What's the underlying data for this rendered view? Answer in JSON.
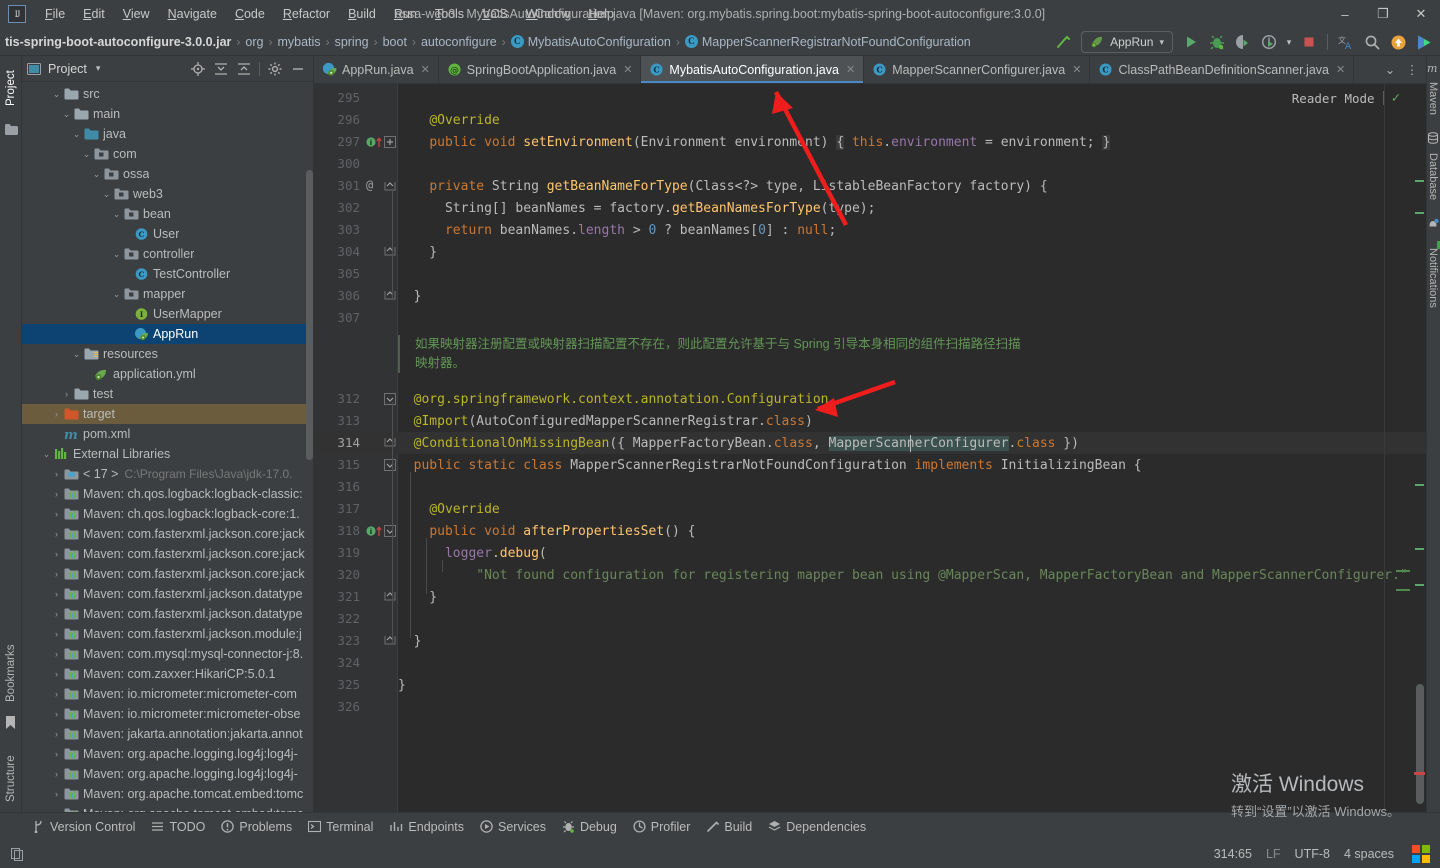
{
  "window": {
    "title": "ossa-web3 - MybatisAutoConfiguration.java [Maven: org.mybatis.spring.boot:mybatis-spring-boot-autoconfigure:3.0.0]",
    "minimize": "–",
    "maximize": "❐",
    "close": "✕",
    "logo": "IJ"
  },
  "menu": {
    "items": [
      {
        "label": "File"
      },
      {
        "label": "Edit"
      },
      {
        "label": "View"
      },
      {
        "label": "Navigate"
      },
      {
        "label": "Code"
      },
      {
        "label": "Refactor"
      },
      {
        "label": "Build"
      },
      {
        "label": "Run"
      },
      {
        "label": "Tools"
      },
      {
        "label": "VCS"
      },
      {
        "label": "Window"
      },
      {
        "label": "Help"
      }
    ]
  },
  "breadcrumb": {
    "items": [
      {
        "label": "tis-spring-boot-autoconfigure-3.0.0.jar",
        "bold": true,
        "icon": ""
      },
      {
        "label": "org",
        "bold": false,
        "icon": ""
      },
      {
        "label": "mybatis",
        "bold": false,
        "icon": ""
      },
      {
        "label": "spring",
        "bold": false,
        "icon": ""
      },
      {
        "label": "boot",
        "bold": false,
        "icon": ""
      },
      {
        "label": "autoconfigure",
        "bold": false,
        "icon": ""
      },
      {
        "label": "MybatisAutoConfiguration",
        "bold": false,
        "icon": "C"
      },
      {
        "label": "MapperScannerRegistrarNotFoundConfiguration",
        "bold": false,
        "icon": "C"
      }
    ],
    "separator": "›"
  },
  "toolbar": {
    "run_config": "AppRun",
    "dropdown_caret": "▾",
    "build_icon": "build-hammer-icon",
    "run_icon": "run-icon",
    "debug_icon": "debug-icon",
    "run_coverage_icon": "run-with-coverage-icon",
    "profiler_icon": "profiler-icon",
    "stop_icon": "stop-icon",
    "translate_icon": "translate-icon",
    "search_icon": "search-everywhere-icon",
    "update_icon": "update-icon",
    "ide_icon": "ide-icon"
  },
  "left_strip": {
    "items": [
      {
        "label": "Project",
        "selected": true
      },
      {
        "label": "Bookmarks",
        "selected": false
      },
      {
        "label": "Structure",
        "selected": false
      }
    ]
  },
  "right_strip": {
    "items": [
      {
        "label": "Maven"
      },
      {
        "label": "Database"
      },
      {
        "label": "Notifications"
      }
    ]
  },
  "project_pane": {
    "title": "Project",
    "caret": "▾",
    "header_icons": [
      "locate-icon",
      "expand-all-icon",
      "collapse-all-icon",
      "settings-gear-icon",
      "hide-icon"
    ],
    "tree": [
      {
        "label": "src",
        "indent": 2,
        "arrow": "⌄",
        "icon": "folder",
        "state": ""
      },
      {
        "label": "main",
        "indent": 3,
        "arrow": "⌄",
        "icon": "folder",
        "state": ""
      },
      {
        "label": "java",
        "indent": 4,
        "arrow": "⌄",
        "icon": "folder-source",
        "state": ""
      },
      {
        "label": "com",
        "indent": 5,
        "arrow": "⌄",
        "icon": "package",
        "state": ""
      },
      {
        "label": "ossa",
        "indent": 6,
        "arrow": "⌄",
        "icon": "package",
        "state": ""
      },
      {
        "label": "web3",
        "indent": 7,
        "arrow": "⌄",
        "icon": "package",
        "state": ""
      },
      {
        "label": "bean",
        "indent": 8,
        "arrow": "⌄",
        "icon": "package",
        "state": ""
      },
      {
        "label": "User",
        "indent": 9,
        "arrow": "",
        "icon": "class",
        "state": ""
      },
      {
        "label": "controller",
        "indent": 8,
        "arrow": "⌄",
        "icon": "package",
        "state": ""
      },
      {
        "label": "TestController",
        "indent": 9,
        "arrow": "",
        "icon": "class",
        "state": ""
      },
      {
        "label": "mapper",
        "indent": 8,
        "arrow": "⌄",
        "icon": "package",
        "state": ""
      },
      {
        "label": "UserMapper",
        "indent": 9,
        "arrow": "",
        "icon": "interface",
        "state": ""
      },
      {
        "label": "AppRun",
        "indent": 9,
        "arrow": "",
        "icon": "spring-class",
        "state": "selected"
      },
      {
        "label": "resources",
        "indent": 4,
        "arrow": "⌄",
        "icon": "folder-resource",
        "state": ""
      },
      {
        "label": "application.yml",
        "indent": 5,
        "arrow": "",
        "icon": "spring-yml",
        "state": ""
      },
      {
        "label": "test",
        "indent": 3,
        "arrow": "›",
        "icon": "folder",
        "state": ""
      },
      {
        "label": "target",
        "indent": 2,
        "arrow": "›",
        "icon": "folder-target",
        "state": "highlighted"
      },
      {
        "label": "pom.xml",
        "indent": 2,
        "arrow": "",
        "icon": "maven",
        "state": ""
      },
      {
        "label": "External Libraries",
        "indent": 1,
        "arrow": "⌄",
        "icon": "libraries",
        "state": ""
      },
      {
        "label": "< 17 >",
        "indent": 2,
        "arrow": "›",
        "icon": "jdk",
        "state": "",
        "dim": "C:\\Program Files\\Java\\jdk-17.0."
      },
      {
        "label": "Maven: ch.qos.logback:logback-classic:",
        "indent": 2,
        "arrow": "›",
        "icon": "lib",
        "state": ""
      },
      {
        "label": "Maven: ch.qos.logback:logback-core:1.",
        "indent": 2,
        "arrow": "›",
        "icon": "lib",
        "state": ""
      },
      {
        "label": "Maven: com.fasterxml.jackson.core:jack",
        "indent": 2,
        "arrow": "›",
        "icon": "lib",
        "state": ""
      },
      {
        "label": "Maven: com.fasterxml.jackson.core:jack",
        "indent": 2,
        "arrow": "›",
        "icon": "lib",
        "state": ""
      },
      {
        "label": "Maven: com.fasterxml.jackson.core:jack",
        "indent": 2,
        "arrow": "›",
        "icon": "lib",
        "state": ""
      },
      {
        "label": "Maven: com.fasterxml.jackson.datatype",
        "indent": 2,
        "arrow": "›",
        "icon": "lib",
        "state": ""
      },
      {
        "label": "Maven: com.fasterxml.jackson.datatype",
        "indent": 2,
        "arrow": "›",
        "icon": "lib",
        "state": ""
      },
      {
        "label": "Maven: com.fasterxml.jackson.module:j",
        "indent": 2,
        "arrow": "›",
        "icon": "lib",
        "state": ""
      },
      {
        "label": "Maven: com.mysql:mysql-connector-j:8.",
        "indent": 2,
        "arrow": "›",
        "icon": "lib",
        "state": ""
      },
      {
        "label": "Maven: com.zaxxer:HikariCP:5.0.1",
        "indent": 2,
        "arrow": "›",
        "icon": "lib",
        "state": ""
      },
      {
        "label": "Maven: io.micrometer:micrometer-com",
        "indent": 2,
        "arrow": "›",
        "icon": "lib",
        "state": ""
      },
      {
        "label": "Maven: io.micrometer:micrometer-obse",
        "indent": 2,
        "arrow": "›",
        "icon": "lib",
        "state": ""
      },
      {
        "label": "Maven: jakarta.annotation:jakarta.annot",
        "indent": 2,
        "arrow": "›",
        "icon": "lib",
        "state": ""
      },
      {
        "label": "Maven: org.apache.logging.log4j:log4j-",
        "indent": 2,
        "arrow": "›",
        "icon": "lib",
        "state": ""
      },
      {
        "label": "Maven: org.apache.logging.log4j:log4j-",
        "indent": 2,
        "arrow": "›",
        "icon": "lib",
        "state": ""
      },
      {
        "label": "Maven: org.apache.tomcat.embed:tomc",
        "indent": 2,
        "arrow": "›",
        "icon": "lib",
        "state": ""
      },
      {
        "label": "Maven: org.apache.tomcat.embed:tomc",
        "indent": 2,
        "arrow": "›",
        "icon": "lib",
        "state": "partial"
      }
    ]
  },
  "editor": {
    "tabs": [
      {
        "label": "AppRun.java",
        "icon": "spring-class",
        "active": false
      },
      {
        "label": "SpringBootApplication.java",
        "icon": "annotation",
        "active": false
      },
      {
        "label": "MybatisAutoConfiguration.java",
        "icon": "class",
        "active": true
      },
      {
        "label": "MapperScannerConfigurer.java",
        "icon": "class",
        "active": false
      },
      {
        "label": "ClassPathBeanDefinitionScanner.java",
        "icon": "class",
        "active": false
      }
    ],
    "tab_close": "✕",
    "overflow_caret": "⌄",
    "overflow_menu": "⋮",
    "reader_mode": {
      "label": "Reader Mode",
      "check": "✓"
    },
    "doc_comment": "如果映射器注册配置或映射器扫描配置不存在，则此配置允许基于与 Spring 引导本身相同的组件扫描路径扫描\n映射器。",
    "doc_line1": "如果映射器注册配置或映射器扫描配置不存在，则此配置允许基于与 Spring 引导本身相同的组件扫描路径扫描",
    "doc_line2": "映射器。",
    "lines": [
      {
        "num": "295",
        "text": ""
      },
      {
        "num": "296",
        "text": "@Override"
      },
      {
        "num": "297",
        "text": "public void setEnvironment(Environment environment) { this.environment = environment; }"
      },
      {
        "num": "300",
        "text": ""
      },
      {
        "num": "301",
        "text": "private String getBeanNameForType(Class<?> type, ListableBeanFactory factory) {"
      },
      {
        "num": "302",
        "text": "String[] beanNames = factory.getBeanNamesForType(type);"
      },
      {
        "num": "303",
        "text": "return beanNames.length > 0 ? beanNames[0] : null;"
      },
      {
        "num": "304",
        "text": "}"
      },
      {
        "num": "305",
        "text": ""
      },
      {
        "num": "306",
        "text": "}"
      },
      {
        "num": "307",
        "text": ""
      },
      {
        "num": "312",
        "text": "@org.springframework.context.annotation.Configuration"
      },
      {
        "num": "313",
        "text": "@Import(AutoConfiguredMapperScannerRegistrar.class)"
      },
      {
        "num": "314",
        "text": "@ConditionalOnMissingBean({ MapperFactoryBean.class, MapperScannerConfigurer.class })"
      },
      {
        "num": "315",
        "text": "public static class MapperScannerRegistrarNotFoundConfiguration implements InitializingBean {"
      },
      {
        "num": "316",
        "text": ""
      },
      {
        "num": "317",
        "text": "@Override"
      },
      {
        "num": "318",
        "text": "public void afterPropertiesSet() {"
      },
      {
        "num": "319",
        "text": "logger.debug("
      },
      {
        "num": "320",
        "text": "\"Not found configuration for registering mapper bean using @MapperScan, MapperFactoryBean and MapperScannerConfigurer.\""
      },
      {
        "num": "321",
        "text": "}"
      },
      {
        "num": "322",
        "text": ""
      },
      {
        "num": "323",
        "text": "}"
      },
      {
        "num": "324",
        "text": ""
      },
      {
        "num": "325",
        "text": "}"
      },
      {
        "num": "326",
        "text": ""
      }
    ]
  },
  "watermark": {
    "line1": "激活 Windows",
    "line2": "转到“设置”以激活 Windows。"
  },
  "bottom_bar": {
    "items": [
      {
        "label": "Version Control",
        "icon": "branch-icon"
      },
      {
        "label": "TODO",
        "icon": "todo-icon"
      },
      {
        "label": "Problems",
        "icon": "problems-icon"
      },
      {
        "label": "Terminal",
        "icon": "terminal-icon"
      },
      {
        "label": "Endpoints",
        "icon": "endpoints-icon"
      },
      {
        "label": "Services",
        "icon": "services-icon"
      },
      {
        "label": "Debug",
        "icon": "debug-icon"
      },
      {
        "label": "Profiler",
        "icon": "profiler-icon"
      },
      {
        "label": "Build",
        "icon": "build-icon"
      },
      {
        "label": "Dependencies",
        "icon": "dependencies-icon"
      }
    ]
  },
  "status_bar": {
    "position": "314:65",
    "line_separator": "LF",
    "encoding": "UTF-8",
    "indent": "4 spaces",
    "memory_icon": "copy-icon",
    "windows_flag": "windows-flag-icon"
  },
  "colors": {
    "accent": "#4a88c7",
    "selection": "#0d4373",
    "editor_bg": "#2b2b2b",
    "panel_bg": "#3c3f41",
    "arrow_red": "#f01d1d",
    "keyword": "#cc7832",
    "annotation": "#bbb529",
    "string": "#6a8759",
    "comment_doc": "#629755",
    "method": "#ffc66d",
    "field": "#9876aa",
    "number": "#6897bb"
  }
}
